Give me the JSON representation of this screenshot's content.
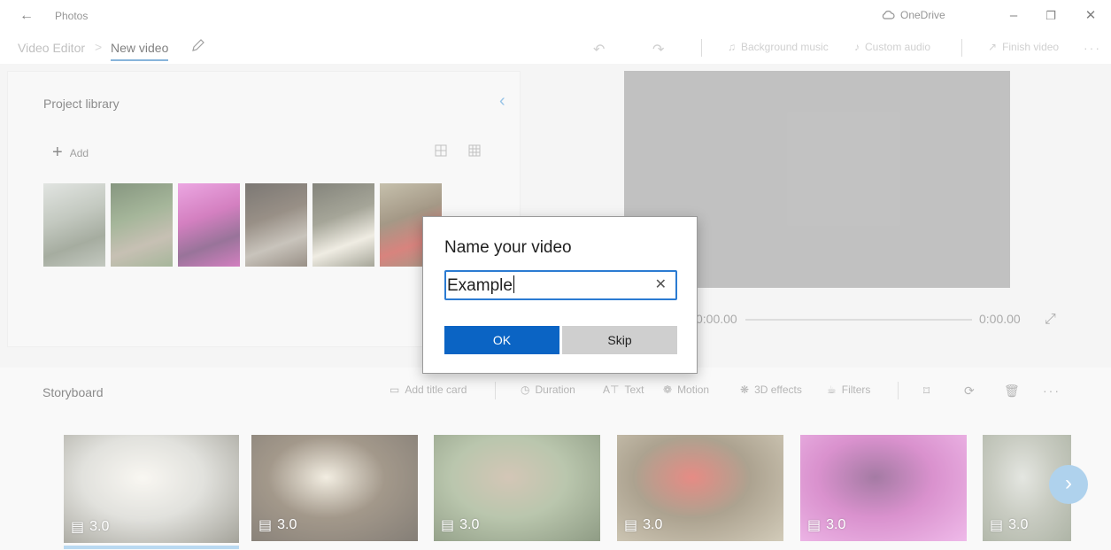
{
  "app": {
    "title": "Photos",
    "onedrive_label": "OneDrive"
  },
  "breadcrumb": {
    "root": "Video Editor",
    "separator": ">",
    "current": "New video"
  },
  "toolbar": {
    "background_music": "Background music",
    "custom_audio": "Custom audio",
    "finish_video": "Finish video"
  },
  "library": {
    "title": "Project library",
    "add_label": "Add",
    "thumbnails": [
      {
        "name": "river-landscape",
        "colors": [
          "#9fa89a",
          "#6f7a66",
          "#cfd4cf"
        ]
      },
      {
        "name": "forest-path",
        "colors": [
          "#6f8a5d",
          "#a59a86",
          "#3d5733"
        ]
      },
      {
        "name": "pink-forest",
        "colors": [
          "#b9329a",
          "#5a1f5c",
          "#e070d0"
        ]
      },
      {
        "name": "fallen-branches",
        "colors": [
          "#5a4c3d",
          "#a8a093",
          "#2b251f"
        ]
      },
      {
        "name": "mushroom-log",
        "colors": [
          "#6f6f5a",
          "#e6e1d2",
          "#3a3a2c"
        ]
      },
      {
        "name": "red-mushroom",
        "colors": [
          "#6d5a3d",
          "#c0382f",
          "#a39a7a"
        ]
      }
    ]
  },
  "preview": {
    "time_start": "0:00.00",
    "time_end": "0:00.00"
  },
  "storyboard": {
    "title": "Storyboard",
    "tools": {
      "add_title_card": "Add title card",
      "duration": "Duration",
      "text": "Text",
      "motion": "Motion",
      "effects_3d": "3D effects",
      "filters": "Filters"
    },
    "clips": [
      {
        "duration": "3.0",
        "colors": [
          "#cfcfc8",
          "#f5f2ea",
          "#6c6a5c"
        ]
      },
      {
        "duration": "3.0",
        "colors": [
          "#6b5a44",
          "#ebe3d0",
          "#3a3024"
        ]
      },
      {
        "duration": "3.0",
        "colors": [
          "#8fa37b",
          "#b9a48a",
          "#4a5f3a"
        ]
      },
      {
        "duration": "3.0",
        "colors": [
          "#7a6a4c",
          "#d7453a",
          "#b7ac8f"
        ]
      },
      {
        "duration": "3.0",
        "colors": [
          "#c34fb0",
          "#6d2a6c",
          "#e590dc"
        ]
      },
      {
        "duration": "3.0",
        "colors": [
          "#a8ad9d",
          "#d4d7cf",
          "#7d8770"
        ]
      }
    ]
  },
  "dialog": {
    "title": "Name your video",
    "input_value": "Example",
    "ok_label": "OK",
    "skip_label": "Skip"
  }
}
